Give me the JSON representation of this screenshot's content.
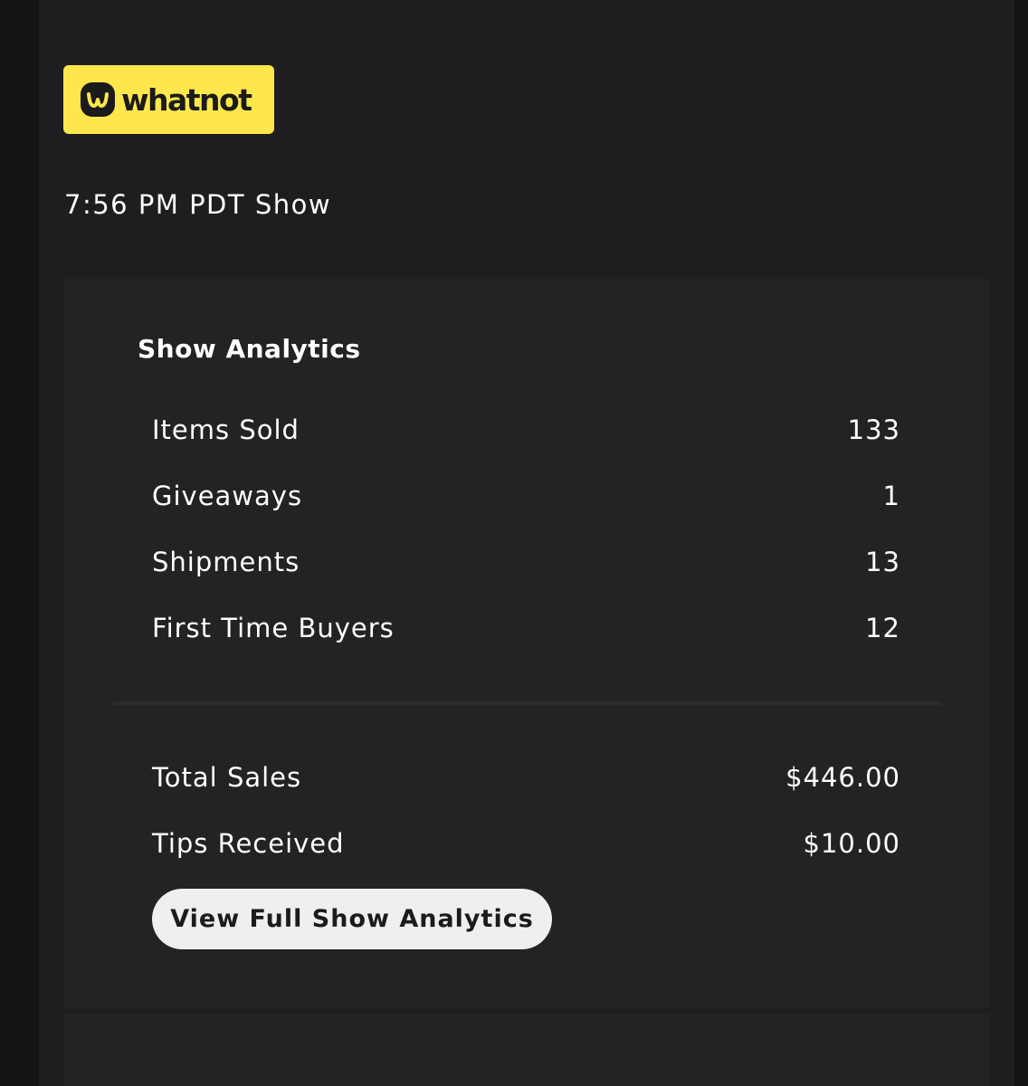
{
  "brand": {
    "name": "whatnot",
    "logo_color": "#fde74c"
  },
  "show": {
    "title": "7:56 PM PDT Show"
  },
  "analytics": {
    "heading": "Show Analytics",
    "counts": [
      {
        "label": "Items Sold",
        "value": "133"
      },
      {
        "label": "Giveaways",
        "value": "1"
      },
      {
        "label": "Shipments",
        "value": "13"
      },
      {
        "label": "First Time Buyers",
        "value": "12"
      }
    ],
    "totals": [
      {
        "label": "Total Sales",
        "value": "$446.00"
      },
      {
        "label": "Tips Received",
        "value": "$10.00"
      }
    ],
    "cta_label": "View Full Show Analytics"
  },
  "colors": {
    "background": "#141416",
    "column": "#1e1e21",
    "card": "#232326",
    "text": "#ffffff",
    "button": "#efefef"
  }
}
